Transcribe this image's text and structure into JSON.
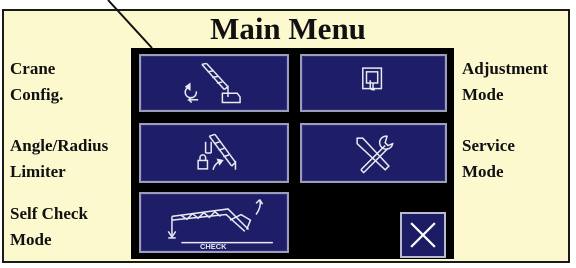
{
  "title": "Main Menu",
  "labels": {
    "crane_config": [
      "Crane",
      "Config."
    ],
    "angle_radius": [
      "Angle/Radius",
      "Limiter"
    ],
    "self_check": [
      "Self Check",
      "Mode"
    ],
    "adjustment": [
      "Adjustment",
      "Mode"
    ],
    "service": [
      "Service",
      "Mode"
    ]
  },
  "buttons": {
    "crane_config_icon": "crane-config-icon",
    "angle_radius_icon": "angle-radius-limiter-icon",
    "self_check_icon": "self-check-icon",
    "self_check_text": "CHECK",
    "adjustment_icon": "adjustment-icon",
    "service_icon": "tools-icon",
    "close_icon": "close-icon"
  },
  "colors": {
    "panel_background": "#fdf9cf",
    "screen_background": "#000000",
    "button_fill": "#1e1e68",
    "button_border": "#9d9db8"
  }
}
